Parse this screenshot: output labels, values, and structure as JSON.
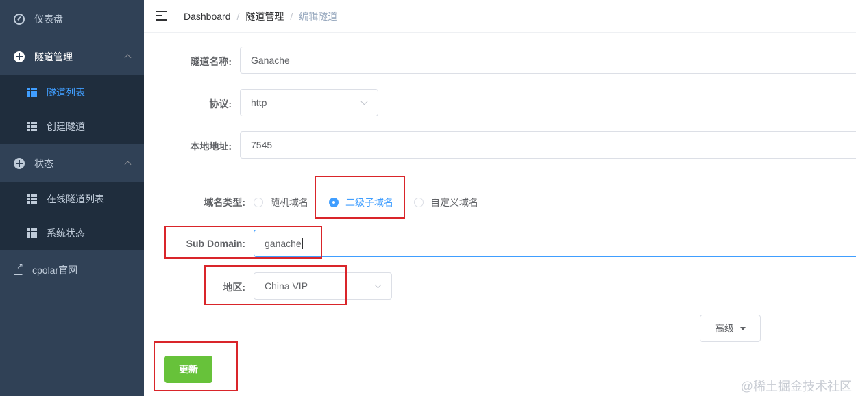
{
  "sidebar": {
    "items": [
      {
        "label": "仪表盘",
        "icon": "dashboard-icon"
      },
      {
        "label": "隧道管理",
        "icon": "plus-circle-icon",
        "expanded": true,
        "children": [
          {
            "label": "隧道列表",
            "icon": "grid-icon",
            "active": true
          },
          {
            "label": "创建隧道",
            "icon": "grid-icon"
          }
        ]
      },
      {
        "label": "状态",
        "icon": "plus-circle-icon",
        "expanded": true,
        "children": [
          {
            "label": "在线隧道列表",
            "icon": "grid-icon"
          },
          {
            "label": "系统状态",
            "icon": "grid-icon"
          }
        ]
      },
      {
        "label": "cpolar官网",
        "icon": "external-link-icon"
      }
    ]
  },
  "navbar": {
    "breadcrumb": [
      "Dashboard",
      "隧道管理",
      "编辑隧道"
    ],
    "separator": "/"
  },
  "form": {
    "tunnel_name": {
      "label": "隧道名称:",
      "value": "Ganache"
    },
    "protocol": {
      "label": "协议:",
      "value": "http"
    },
    "local_address": {
      "label": "本地地址:",
      "value": "7545"
    },
    "domain_type": {
      "label": "域名类型:",
      "options": [
        "随机域名",
        "二级子域名",
        "自定义域名"
      ],
      "selected": "二级子域名"
    },
    "sub_domain": {
      "label": "Sub Domain:",
      "value": "ganache"
    },
    "region": {
      "label": "地区:",
      "value": "China VIP"
    },
    "advanced_label": "高级",
    "submit_label": "更新"
  },
  "watermark": "@稀土掘金技术社区",
  "colors": {
    "sidebar_bg": "#304156",
    "submenu_bg": "#1f2d3d",
    "active_blue": "#409eff",
    "success_green": "#67c23a",
    "highlight_red": "#d9252a"
  }
}
